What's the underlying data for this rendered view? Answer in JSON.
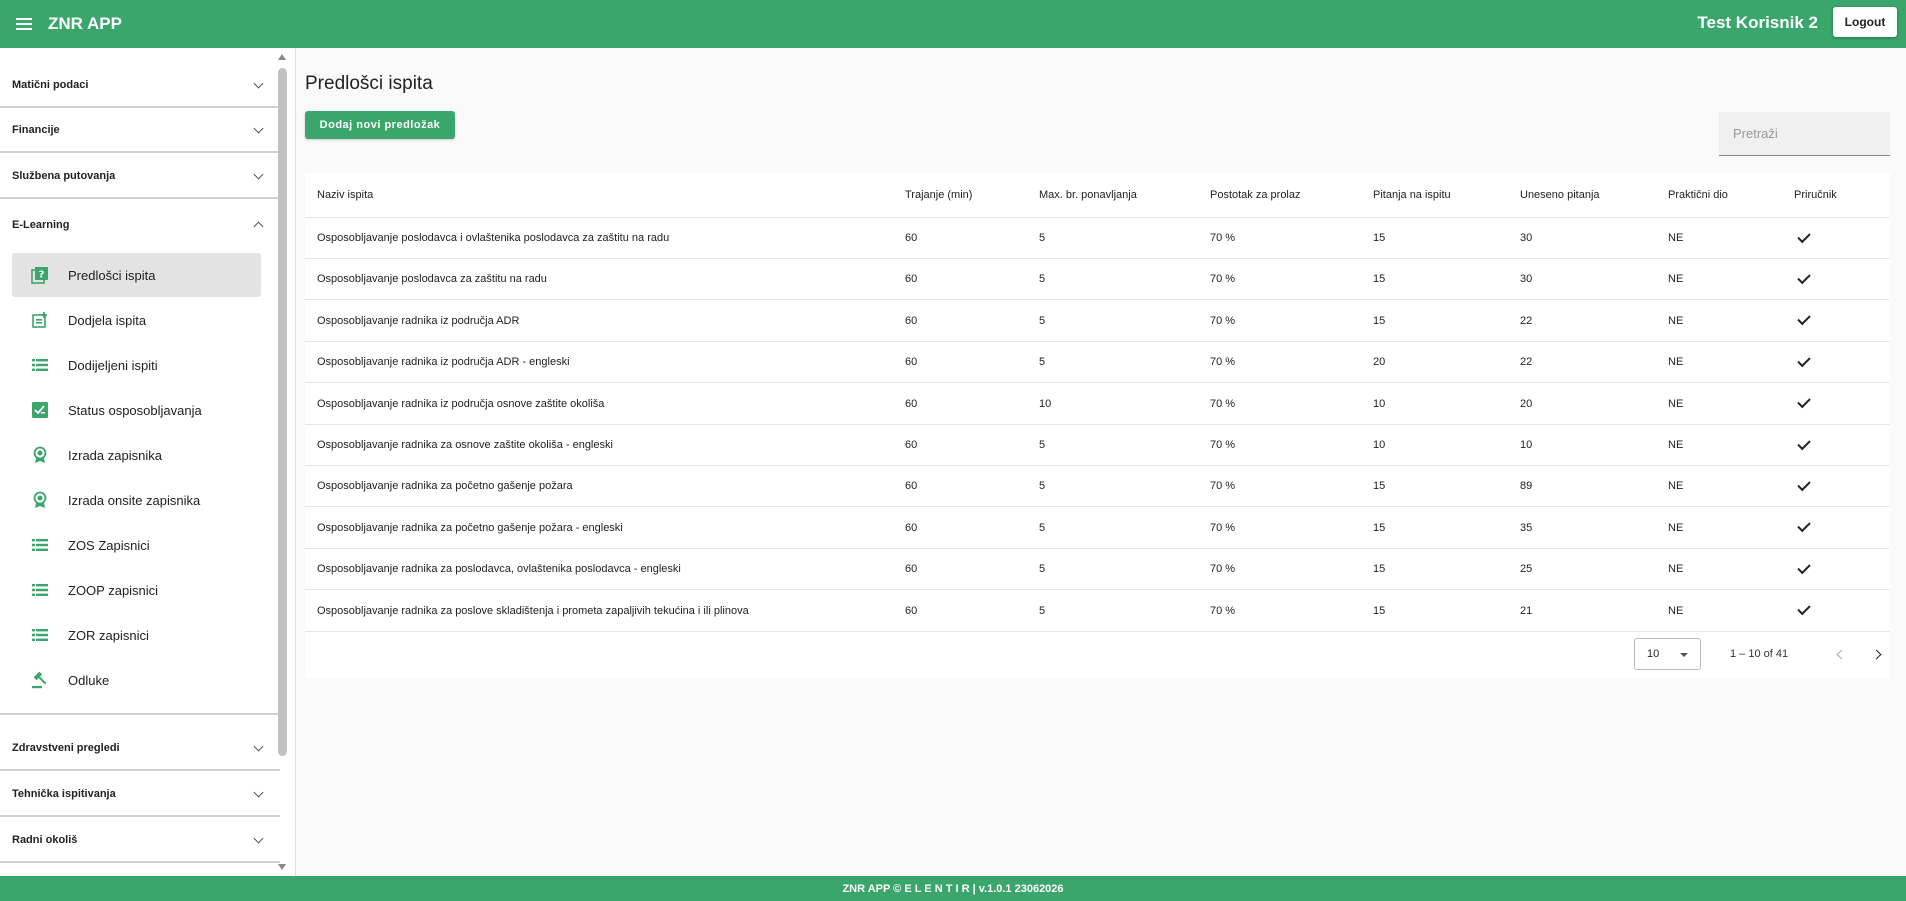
{
  "app": {
    "title": "ZNR APP",
    "user": "Test Korisnik 2",
    "logout_label": "Logout"
  },
  "sidebar": {
    "sections_top": [
      {
        "label": "Matični podaci"
      },
      {
        "label": "Financije"
      },
      {
        "label": "Službena putovanja"
      },
      {
        "label": "E-Learning"
      }
    ],
    "elearning_items": [
      {
        "label": "Predlošci ispita",
        "icon": "quiz-icon"
      },
      {
        "label": "Dodjela ispita",
        "icon": "add-assignment-icon"
      },
      {
        "label": "Dodijeljeni ispiti",
        "icon": "list-icon"
      },
      {
        "label": "Status osposobljavanja",
        "icon": "checked-box-icon"
      },
      {
        "label": "Izrada zapisnika",
        "icon": "award-icon"
      },
      {
        "label": "Izrada onsite zapisnika",
        "icon": "award-icon"
      },
      {
        "label": "ZOS Zapisnici",
        "icon": "list-icon"
      },
      {
        "label": "ZOOP zapisnici",
        "icon": "list-icon"
      },
      {
        "label": "ZOR zapisnici",
        "icon": "list-icon"
      },
      {
        "label": "Odluke",
        "icon": "gavel-icon"
      }
    ],
    "sections_bottom": [
      {
        "label": "Zdravstveni pregledi"
      },
      {
        "label": "Tehnička ispitivanja"
      },
      {
        "label": "Radni okoliš"
      }
    ]
  },
  "main": {
    "title": "Predlošci ispita",
    "add_button": "Dodaj novi predložak",
    "search_placeholder": "Pretraži",
    "columns": [
      "Naziv ispita",
      "Trajanje (min)",
      "Max. br. ponavljanja",
      "Postotak za prolaz",
      "Pitanja na ispitu",
      "Uneseno pitanja",
      "Praktični dio",
      "Priručnik"
    ],
    "rows": [
      [
        "Osposobljavanje poslodavca i ovlaštenika poslodavca za zaštitu na radu",
        "60",
        "5",
        "70 %",
        "15",
        "30",
        "NE"
      ],
      [
        "Osposobljavanje poslodavca za zaštitu na radu",
        "60",
        "5",
        "70 %",
        "15",
        "30",
        "NE"
      ],
      [
        "Osposobljavanje radnika iz područja ADR",
        "60",
        "5",
        "70 %",
        "15",
        "22",
        "NE"
      ],
      [
        "Osposobljavanje radnika iz područja ADR - engleski",
        "60",
        "5",
        "70 %",
        "20",
        "22",
        "NE"
      ],
      [
        "Osposobljavanje radnika iz područja osnove zaštite okoliša",
        "60",
        "10",
        "70 %",
        "10",
        "20",
        "NE"
      ],
      [
        "Osposobljavanje radnika za osnove zaštite okoliša - engleski",
        "60",
        "5",
        "70 %",
        "10",
        "10",
        "NE"
      ],
      [
        "Osposobljavanje radnika za početno gašenje požara",
        "60",
        "5",
        "70 %",
        "15",
        "89",
        "NE"
      ],
      [
        "Osposobljavanje radnika za početno gašenje požara - engleski",
        "60",
        "5",
        "70 %",
        "15",
        "35",
        "NE"
      ],
      [
        "Osposobljavanje radnika za poslodavca, ovlaštenika poslodavca - engleski",
        "60",
        "5",
        "70 %",
        "15",
        "25",
        "NE"
      ],
      [
        "Osposobljavanje radnika za poslove skladištenja i prometa zapaljivih tekućina i ili plinova",
        "60",
        "5",
        "70 %",
        "15",
        "21",
        "NE"
      ]
    ],
    "paginator": {
      "page_size": "10",
      "range": "1 – 10 of 41"
    }
  },
  "footer": {
    "text": "ZNR APP © E L E N T I R | v.1.0.1 23062026"
  },
  "colors": {
    "primary": "#3aa66b",
    "active_bg": "#e3e3e3"
  }
}
